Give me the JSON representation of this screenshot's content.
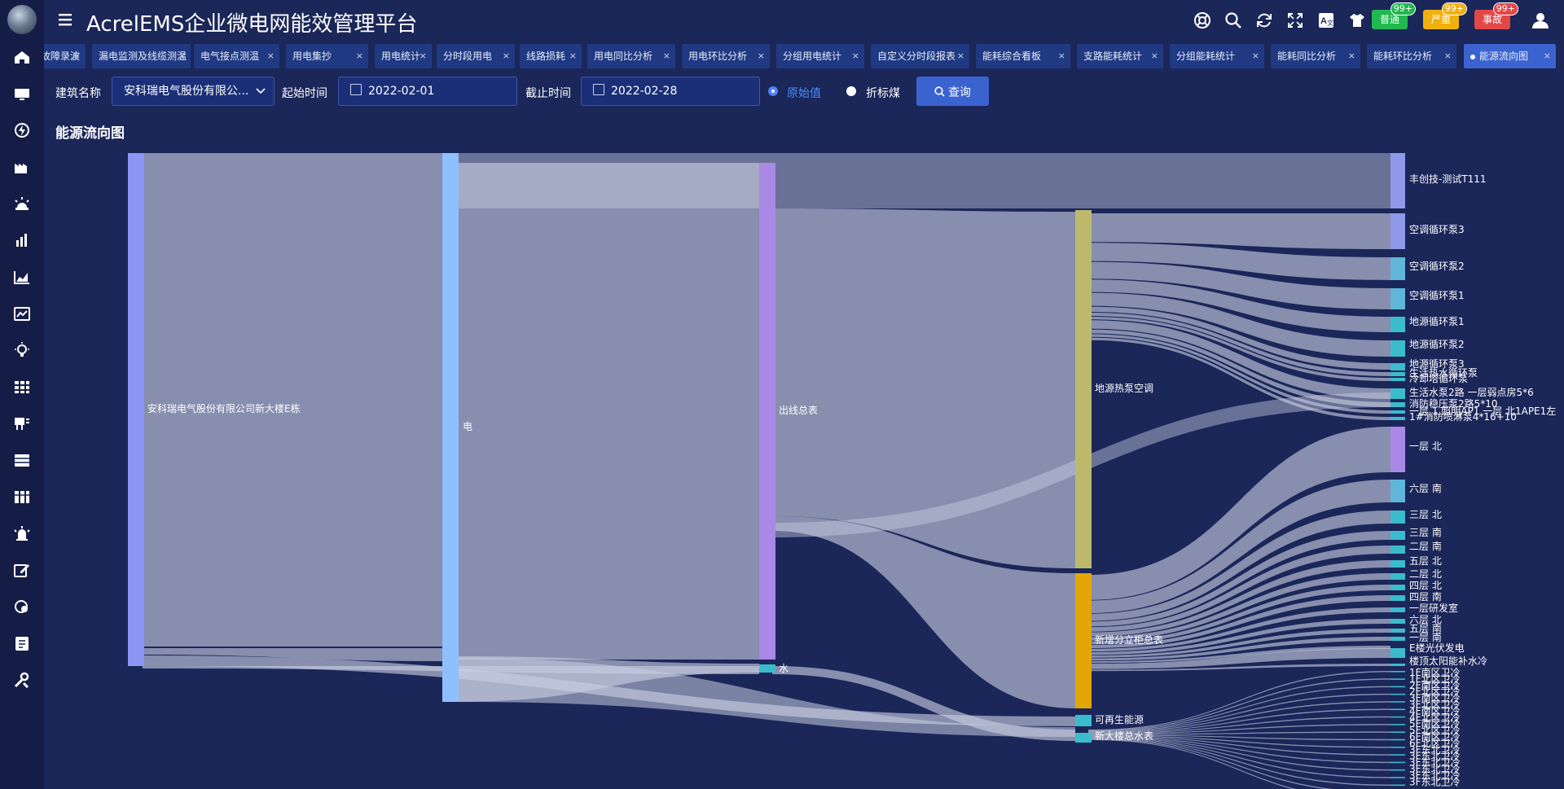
{
  "app": {
    "title": "AcrelEMS企业微电网能效管理平台"
  },
  "sidebar": {
    "items": [
      {
        "icon": "home-icon"
      },
      {
        "icon": "monitor-icon"
      },
      {
        "icon": "lightning-icon"
      },
      {
        "icon": "factory-icon"
      },
      {
        "icon": "alarm-icon"
      },
      {
        "icon": "bar-chart-icon"
      },
      {
        "icon": "area-chart-icon"
      },
      {
        "icon": "line-chart-icon"
      },
      {
        "icon": "bulb-icon"
      },
      {
        "icon": "grid-icon"
      },
      {
        "icon": "transformer-icon"
      },
      {
        "icon": "panel-icon"
      },
      {
        "icon": "cabinet-icon"
      },
      {
        "icon": "alarm-light-icon"
      },
      {
        "icon": "edit-icon"
      },
      {
        "icon": "settings-view-icon"
      },
      {
        "icon": "document-icon"
      },
      {
        "icon": "tools-icon"
      }
    ]
  },
  "toolbar": {
    "icons": [
      "help-circle-icon",
      "search-icon",
      "refresh-icon",
      "fullscreen-icon",
      "language-icon",
      "theme-shirt-icon"
    ],
    "alarms": [
      {
        "label": "普通",
        "count": "99+",
        "color": "#21b94f"
      },
      {
        "label": "严重",
        "count": "99+",
        "color": "#f0b10d"
      },
      {
        "label": "事故",
        "count": "99+",
        "color": "#e24848"
      }
    ],
    "user_icon": "user-icon"
  },
  "tabs": [
    {
      "label": "故障录波"
    },
    {
      "label": "漏电监测及线缆测温"
    },
    {
      "label": "电气接点测温"
    },
    {
      "label": "用电集抄"
    },
    {
      "label": "用电统计"
    },
    {
      "label": "分时段用电"
    },
    {
      "label": "线路损耗"
    },
    {
      "label": "用电同比分析"
    },
    {
      "label": "用电环比分析"
    },
    {
      "label": "分组用电统计"
    },
    {
      "label": "自定义分时段报表"
    },
    {
      "label": "能耗综合看板"
    },
    {
      "label": "支路能耗统计"
    },
    {
      "label": "分组能耗统计"
    },
    {
      "label": "能耗同比分析"
    },
    {
      "label": "能耗环比分析"
    },
    {
      "label": "能源流向图",
      "active": true
    }
  ],
  "filters": {
    "building_label": "建筑名称",
    "building_value": "安科瑞电气股份有限公...",
    "start_label": "起始时间",
    "start_value": "2022-02-01",
    "end_label": "截止时间",
    "end_value": "2022-02-28",
    "radio_original": "原始值",
    "radio_coal": "折标煤",
    "query_button": "查询"
  },
  "page": {
    "section_title": "能源流向图"
  },
  "chart_data": {
    "type": "sankey",
    "nodes": [
      {
        "name": "安科瑞电气股份有限公司新大楼E栋"
      },
      {
        "name": "电"
      },
      {
        "name": "出线总表"
      },
      {
        "name": "水"
      },
      {
        "name": "地源热泵空调"
      },
      {
        "name": "新增分立柜总表"
      },
      {
        "name": "可再生能源"
      },
      {
        "name": "新大楼总水表"
      },
      {
        "name": "丰创技-测试T111"
      },
      {
        "name": "空调循环泵3"
      },
      {
        "name": "空调循环泵2"
      },
      {
        "name": "空调循环泵1"
      },
      {
        "name": "地源循环泵1"
      },
      {
        "name": "地源循环泵2"
      },
      {
        "name": "地源循环泵3"
      },
      {
        "name": "生活热水循环泵"
      },
      {
        "name": "冷却塔循环泵"
      },
      {
        "name": "生活水泵2路 一层弱点房5*6"
      },
      {
        "name": "消防稳压泵2路5*10"
      },
      {
        "name": "一层 1 照明AP1 一层 北1APE1左"
      },
      {
        "name": "1#消防喷淋泵4*16+10"
      },
      {
        "name": "一层 北"
      },
      {
        "name": "六层 南"
      },
      {
        "name": "三层 北"
      },
      {
        "name": "三层 南"
      },
      {
        "name": "二层 南"
      },
      {
        "name": "五层 北"
      },
      {
        "name": "二层 北"
      },
      {
        "name": "四层 北"
      },
      {
        "name": "四层 南"
      },
      {
        "name": "一层研发室"
      },
      {
        "name": "六层 北"
      },
      {
        "name": "五层 南"
      },
      {
        "name": "一层 南"
      },
      {
        "name": "E楼光伏发电"
      },
      {
        "name": "楼顶太阳能补水冷"
      },
      {
        "name": "1F南区卫冷"
      },
      {
        "name": "1F北区卫冷"
      },
      {
        "name": "2F南区卫冷"
      },
      {
        "name": "2F北区卫冷"
      },
      {
        "name": "3F南区卫冷"
      },
      {
        "name": "3F北区卫冷"
      },
      {
        "name": "4F南区卫冷"
      },
      {
        "name": "4F北区卫冷"
      },
      {
        "name": "5F南区卫冷"
      },
      {
        "name": "5F北区卫冷"
      },
      {
        "name": "6F南区卫冷"
      },
      {
        "name": "6F北区卫冷"
      },
      {
        "name": "3F东北卫冷"
      },
      {
        "name": "3F东北卫冷"
      },
      {
        "name": "3F东北卫冷"
      },
      {
        "name": "3F东北卫冷"
      },
      {
        "name": "3F东北卫冷"
      },
      {
        "name": "3F东北卫冷"
      }
    ],
    "links": [
      {
        "source": "安科瑞电气股份有限公司新大楼E栋",
        "target": "电",
        "value": 680
      },
      {
        "source": "安科瑞电气股份有限公司新大楼E栋",
        "target": "可再生能源",
        "value": 12
      },
      {
        "source": "安科瑞电气股份有限公司新大楼E栋",
        "target": "水",
        "value": 12
      },
      {
        "source": "电",
        "target": "出线总表",
        "value": 610
      },
      {
        "source": "电",
        "target": "丰创技-测试T111",
        "value": 70
      },
      {
        "source": "水",
        "target": "新大楼总水表",
        "value": 12
      },
      {
        "source": "出线总表",
        "target": "地源热泵空调",
        "value": 440
      },
      {
        "source": "出线总表",
        "target": "新增分立柜总表",
        "value": 170
      }
    ]
  }
}
